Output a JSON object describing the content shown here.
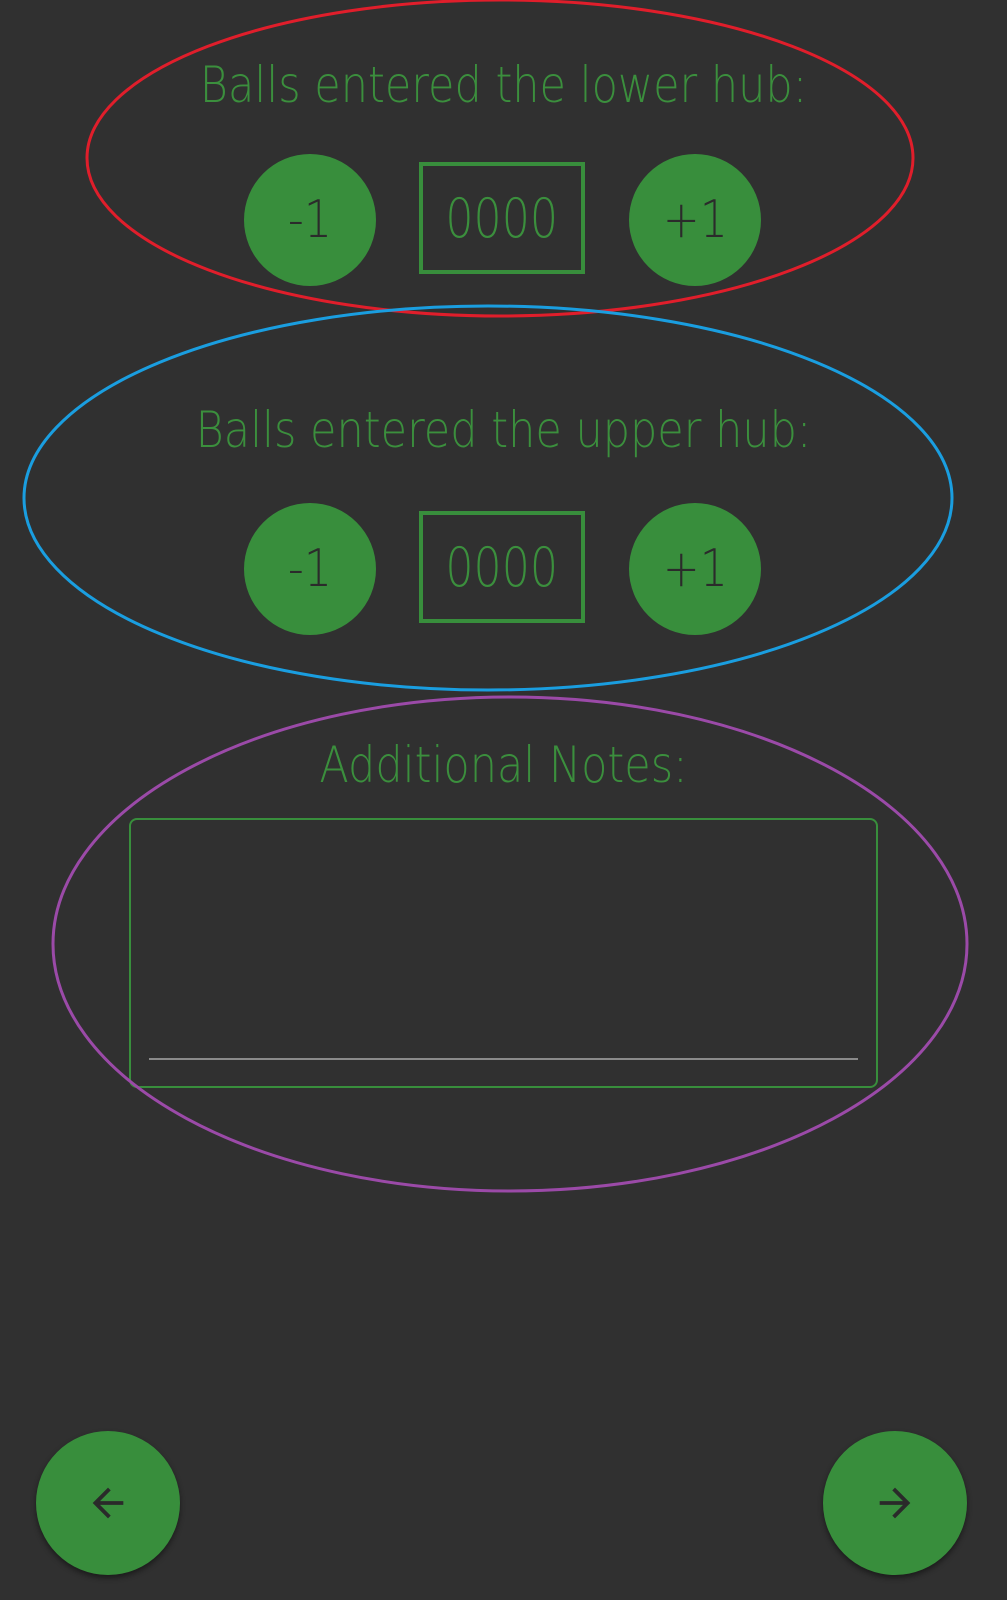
{
  "lower_hub": {
    "title": "Balls entered the lower hub:",
    "minus_label": "-1",
    "count": "0000",
    "plus_label": "+1"
  },
  "upper_hub": {
    "title": "Balls entered the upper hub:",
    "minus_label": "-1",
    "count": "0000",
    "plus_label": "+1"
  },
  "notes": {
    "title": "Additional Notes:",
    "value": ""
  },
  "navigation": {
    "back_icon": "arrow-left-icon",
    "next_icon": "arrow-right-icon"
  },
  "colors": {
    "background": "#303030",
    "accent_green": "#388e3c",
    "text_green": "#3b8f3d",
    "annotation_red": "#e01e2b",
    "annotation_blue": "#1a9ee0",
    "annotation_purple": "#9b4aa8"
  }
}
